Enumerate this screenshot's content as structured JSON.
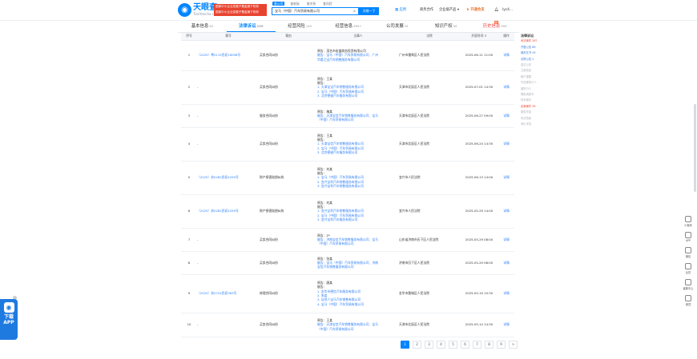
{
  "header": {
    "logo_cn": "天眼查",
    "logo_en": "TianYancha.com",
    "ad_lines": [
      "国家中小企业发展子基金旗下机构",
      "国家中小企业发展子基金旗下机构"
    ],
    "search_tabs": [
      "查公司",
      "查老板",
      "查关系",
      "查风险"
    ],
    "search_value": "宝马（中国）汽车贸易有限公司",
    "search_button": "天眼一下",
    "nav": [
      "应用",
      "商务合作",
      "企业级产品",
      "开通会员",
      "lyc4..."
    ]
  },
  "tabs": [
    {
      "label": "基本信息",
      "count": "60"
    },
    {
      "label": "法律诉讼",
      "count": "139"
    },
    {
      "label": "经营风险",
      "count": "140"
    },
    {
      "label": "经营信息",
      "count": "999+"
    },
    {
      "label": "公司发展",
      "count": "34"
    },
    {
      "label": "知识产权",
      "count": "99"
    },
    {
      "label": "历史信息",
      "count": "999"
    }
  ],
  "history_badge": "新",
  "table": {
    "headers": [
      "序号",
      "案号",
      "案由",
      "当事人",
      "法院",
      "开庭时间",
      "操作"
    ],
    "rows": [
      {
        "no": "1",
        "case_no": "（2025）粤0115民初16098号",
        "cause": "买卖合同纠纷",
        "parties": [
          "原告：茂名市宏盛商务投资有限公司",
          "被告：宝马（中国）汽车贸易有限公司、广州",
          "华晨之宝汽车销售服务有限公司"
        ],
        "court": "广州市番禺区人民法院",
        "time": "2025-06-11 11:00",
        "op": "详情"
      },
      {
        "no": "2",
        "case_no": "-",
        "cause": "买卖合同纠纷",
        "parties": [
          "原告：王某",
          "被告：",
          "1. 天津宝宝汽车销售服务有限公司",
          "2. 宝马（中国）汽车贸易有限公司",
          "3. 北京德骏汽车服务有限公司"
        ],
        "court": "天津市北辰区人民法院",
        "time": "2025-07-01 14:30",
        "op": "详情"
      },
      {
        "no": "3",
        "case_no": "-",
        "cause": "服务合同纠纷",
        "parties": [
          "原告：梅某",
          "被告：天津宝信汽车销售服务有限公司、宝马",
          "（中国）汽车贸易有限公司"
        ],
        "court": "天津市北辰区人民法院",
        "time": "2025-06-27 09:00",
        "op": "详情"
      },
      {
        "no": "4",
        "case_no": "-",
        "cause": "买卖合同纠纷",
        "parties": [
          "原告：王某",
          "被告：",
          "1. 天津宝信汽车销售服务有限公司",
          "2. 宝马（中国）汽车贸易有限公司",
          "3. 北京德骏汽车服务有限公司"
        ],
        "court": "天津市北辰区人民法院",
        "time": "2025-06-24 14:30",
        "op": "详情"
      },
      {
        "no": "5",
        "case_no": "（2025）苏0282民初4259号",
        "cause": "财产损害赔偿纠纷",
        "parties": [
          "原告：刘某",
          "被告：",
          "1. 宝马（中国）汽车贸易有限公司",
          "2. 宜兴宝利汽车销售服务有限公司",
          "3. 宜兴宝利汽车销售服务有限公司"
        ],
        "court": "宜兴市人民法院",
        "time": "2025-06-13 14:00",
        "op": "详情"
      },
      {
        "no": "6",
        "case_no": "（2025）苏0282民初4259号",
        "cause": "财产损害赔偿纠纷",
        "parties": [
          "原告：刘某",
          "被告：",
          "1. 宜兴宝利汽车销售服务有限公司",
          "2. 宝马（中国）汽车贸易有限公司",
          "3. 宜兴宝利汽车服务有限公司"
        ],
        "court": "宜兴市人民法院",
        "time": "2025-05-29 14:00",
        "op": "详情"
      },
      {
        "no": "7",
        "case_no": "-",
        "cause": "买卖合同纠纷",
        "parties": [
          "原告：Z*",
          "被告：济南宝信汽车销售服务有限公司、宝马",
          "（中国）汽车贸易有限公司"
        ],
        "court": "山东省济南市历下区人民法院",
        "time": "2025-05-29 08:00",
        "op": "详情"
      },
      {
        "no": "8",
        "case_no": "-",
        "cause": "买卖合同纠纷",
        "parties": [
          "原告：张某",
          "被告：宝马（中国）汽车贸易有限公司、济南",
          "宝信汽车销售服务有限公司"
        ],
        "court": "济南市历下区人民法院",
        "time": "2025-05-29 08:00",
        "op": "详情"
      },
      {
        "no": "9",
        "case_no": "（2025）苏0724民初363号",
        "cause": "修理合同纠纷",
        "parties": [
          "原告：唐某",
          "被告：",
          "1. 金华市德信汽车服务有限公司",
          "2. 朱某",
          "3. 自然人宝马汽车销售有限公司",
          "4. 宝马（中国）汽车贸易有限公司"
        ],
        "court": "金华市婺城区人民法院",
        "time": "2025-05-19 10:30",
        "op": "详情"
      },
      {
        "no": "10",
        "case_no": "-",
        "cause": "买卖合同纠纷",
        "parties": [
          "原告：王某",
          "被告：天津宝信汽车销售服务有限公司、宝马",
          "（中国）汽车贸易有限公司"
        ],
        "court": "天津市北辰区人民法院",
        "time": "2025-05-14 14:30",
        "op": "详情"
      }
    ]
  },
  "side_filter": {
    "title": "法律诉讼",
    "items": [
      {
        "label": "司法案件 287",
        "style": "red"
      },
      {
        "label": "开庭公告 88",
        "style": "on"
      },
      {
        "label": "裁判文书 49",
        "style": "on"
      },
      {
        "label": "法院公告 2",
        "style": "on"
      },
      {
        "label": "送达公告",
        "style": "off"
      },
      {
        "label": "立案信息",
        "style": "off"
      },
      {
        "label": "破产重整",
        "style": "off"
      },
      {
        "label": "失信被执行人",
        "style": "off"
      },
      {
        "label": "被执行人",
        "style": "off"
      },
      {
        "label": "限制消费令",
        "style": "off"
      },
      {
        "label": "终本案件",
        "style": "off"
      },
      {
        "label": "定案案件 28",
        "style": "red"
      },
      {
        "label": "股权冻结",
        "style": "off"
      },
      {
        "label": "司法拍卖",
        "style": "off"
      },
      {
        "label": "询价评估",
        "style": "off"
      }
    ]
  },
  "pager": [
    "1",
    "2",
    "3",
    "4",
    "5",
    "6",
    "7",
    "8",
    "9",
    ">"
  ],
  "right_tools": [
    "小程序",
    "APP",
    "微信",
    "反馈",
    "客服中心",
    "置顶"
  ],
  "app_float": {
    "line1": "下载",
    "line2": "APP"
  }
}
